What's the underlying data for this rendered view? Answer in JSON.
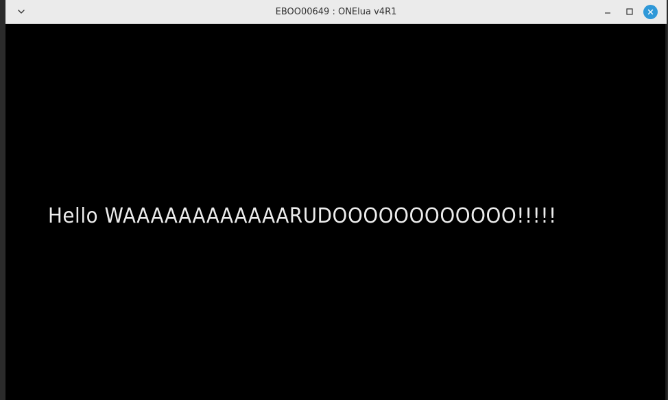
{
  "window": {
    "title": "EBOO00649 : ONElua v4R1",
    "buttons": {
      "menu_icon": "chevron-down-icon",
      "minimize_icon": "minimize-icon",
      "maximize_icon": "maximize-icon",
      "close_icon": "close-icon"
    },
    "colors": {
      "titlebar": "#ebebeb",
      "close_button": "#2f98d8",
      "content_background": "#000000",
      "text": "#ececec"
    }
  },
  "content": {
    "message": "Hello WAAAAAAAAAAAARUDOOOOOOOOOOOO!!!!!"
  }
}
